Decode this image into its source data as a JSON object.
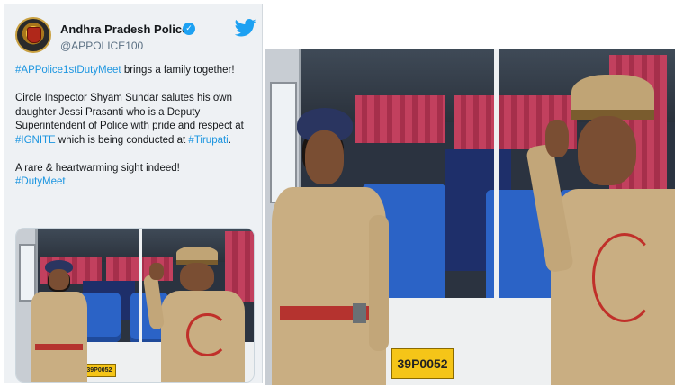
{
  "tweet": {
    "display_name": "Andhra Pradesh Police",
    "handle": "@APPOLICE100",
    "verified_icon": "verified-badge-icon",
    "platform_icon": "twitter-bird-icon",
    "body": {
      "p1_tag": "#APPolice1stDutyMeet",
      "p1_text": " brings a family together!",
      "p2_text_a": "Circle Inspector Shyam Sundar salutes his own daughter Jessi Prasanti who is a Deputy Superintendent of Police with pride and respect at ",
      "p2_tag_a": "#IGNITE",
      "p2_text_b": " which is being conducted at ",
      "p2_tag_b": "#Tirupati",
      "p2_text_c": ".",
      "p3_text": "A rare & heartwarming sight indeed!",
      "p3_tag": "#DutyMeet"
    }
  },
  "photo": {
    "plate_text": "39P0052"
  },
  "colors": {
    "link": "#1b95e0",
    "twitter_blue": "#1da1f2",
    "card_bg": "#eef1f4"
  }
}
